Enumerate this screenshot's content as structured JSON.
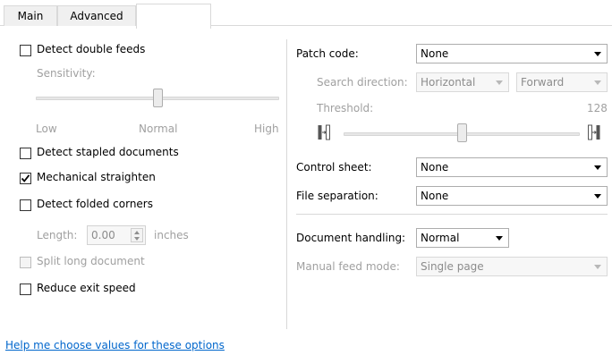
{
  "tabs": [
    {
      "label": "Main"
    },
    {
      "label": "Advanced"
    }
  ],
  "left": {
    "detect_double_feeds": {
      "label": "Detect double feeds",
      "checked": false
    },
    "sensitivity": {
      "label": "Sensitivity:",
      "low": "Low",
      "normal": "Normal",
      "high": "High",
      "level": 0.5
    },
    "detect_stapled": {
      "label": "Detect stapled documents",
      "checked": false
    },
    "mechanical_straighten": {
      "label": "Mechanical straighten",
      "checked": true
    },
    "detect_folded_corners": {
      "label": "Detect folded corners",
      "checked": false
    },
    "length": {
      "label": "Length:",
      "value": "0.00",
      "unit": "inches"
    },
    "split_long_document": {
      "label": "Split long document",
      "checked": false
    },
    "reduce_exit_speed": {
      "label": "Reduce exit speed",
      "checked": false
    }
  },
  "right": {
    "patch_code": {
      "label": "Patch code:",
      "value": "None"
    },
    "search_direction": {
      "label": "Search direction:",
      "value1": "Horizontal",
      "value2": "Forward"
    },
    "threshold": {
      "label": "Threshold:",
      "value": "128",
      "level": 0.5
    },
    "control_sheet": {
      "label": "Control sheet:",
      "value": "None"
    },
    "file_separation": {
      "label": "File separation:",
      "value": "None"
    },
    "document_handling": {
      "label": "Document handling:",
      "value": "Normal"
    },
    "manual_feed_mode": {
      "label": "Manual feed mode:",
      "value": "Single page"
    }
  },
  "help_link": "Help me choose values for these options"
}
